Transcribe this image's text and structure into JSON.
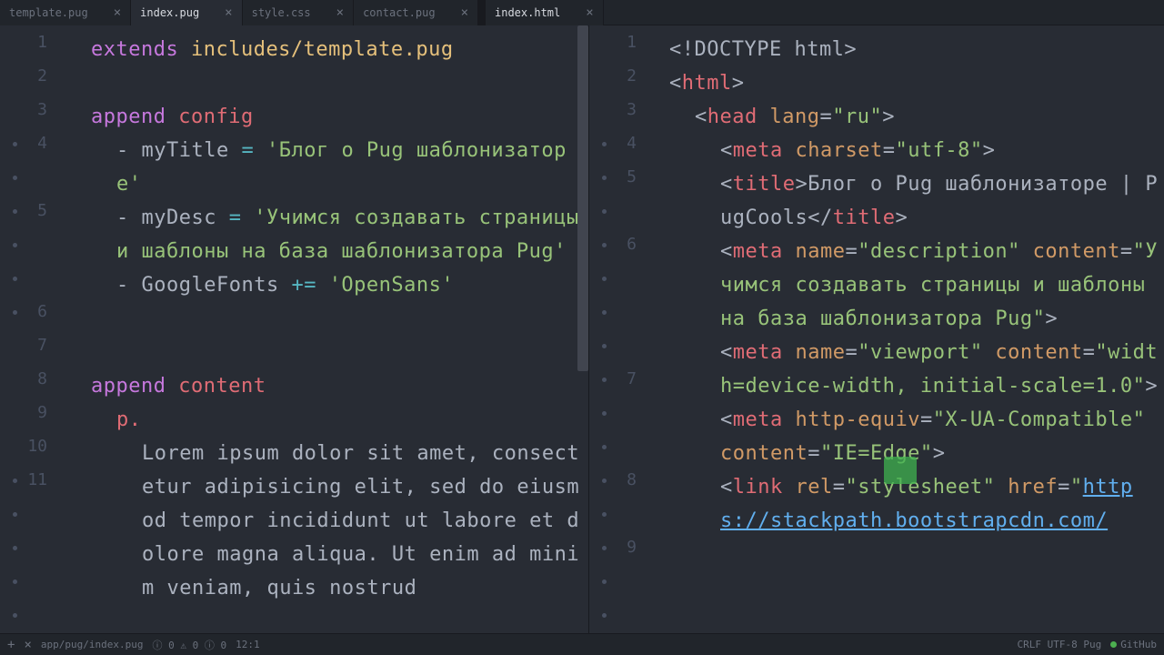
{
  "tabs": [
    {
      "label": "template.pug",
      "active": false
    },
    {
      "label": "index.pug",
      "active": true
    },
    {
      "label": "style.css",
      "active": false
    },
    {
      "label": "contact.pug",
      "active": false
    },
    {
      "label": "index.html",
      "active": true
    }
  ],
  "left_lines": [
    "1",
    "2",
    "3",
    "4",
    "",
    "5",
    "",
    "",
    "6",
    "7",
    "8",
    "9",
    "10",
    "11",
    "",
    "",
    "",
    ""
  ],
  "right_lines": [
    "1",
    "2",
    "3",
    "4",
    "5",
    "",
    "6",
    "",
    "",
    "",
    "7",
    "",
    "",
    "8",
    "",
    "9",
    "",
    ""
  ],
  "left_code": {
    "l1_kw": "extends",
    "l1_path": "includes/template.pug",
    "l3_kw": "append",
    "l3_name": "config",
    "l4_dash": "- ",
    "l4_var": "myTitle",
    "l4_eq": " = ",
    "l4_str": "'Блог о Pug шаблонизаторе'",
    "l5_dash": "- ",
    "l5_var": "myDesc",
    "l5_eq": " = ",
    "l5_str": "'Учимся создавать страницы и шаблоны на база шаблонизатора Pug'",
    "l6_dash": "- ",
    "l6_var": "GoogleFonts",
    "l6_eq": " += ",
    "l6_str": "'OpenSans'",
    "l9_kw": "append",
    "l9_name": "content",
    "l10_tag": "p.",
    "l11_text": "Lorem ipsum dolor sit amet, consectetur adipisicing elit, sed do eiusmod tempor incididunt ut labore et dolore magna aliqua. Ut enim ad minim veniam, quis nostrud"
  },
  "right_code": {
    "r1": "<!DOCTYPE html>",
    "r2_o": "<",
    "r2_t": "html",
    "r2_c": ">",
    "r3_o": "<",
    "r3_t": "head",
    "r3_sp": " ",
    "r3_a": "lang",
    "r3_eq": "=",
    "r3_v": "\"ru\"",
    "r3_c": ">",
    "r4_o": "<",
    "r4_t": "meta",
    "r4_sp": " ",
    "r4_a": "charset",
    "r4_eq": "=",
    "r4_v": "\"utf-8\"",
    "r4_c": ">",
    "r5_o": "<",
    "r5_t": "title",
    "r5_c": ">",
    "r5_txt": "Блог о Pug шаблонизаторе | PugCools",
    "r5_co": "</",
    "r5_ct": "title",
    "r5_cc": ">",
    "r6_o": "<",
    "r6_t": "meta",
    "r6_sp": " ",
    "r6_a1": "name",
    "r6_eq": "=",
    "r6_v1": "\"description\"",
    "r6_a2": "content",
    "r6_v2": "\"Учимся создавать страницы и шаблоны на база шаблонизатора Pug\"",
    "r6_c": ">",
    "r7_o": "<",
    "r7_t": "meta",
    "r7_sp": " ",
    "r7_a1": "name",
    "r7_eq": "=",
    "r7_v1": "\"viewport\"",
    "r7_a2": "content",
    "r7_v2": "\"width=device-width, initial-scale=1.0\"",
    "r7_c": ">",
    "r8_o": "<",
    "r8_t": "meta",
    "r8_sp": " ",
    "r8_a1": "http-equiv",
    "r8_eq": "=",
    "r8_v1": "\"X-UA-Compatible\"",
    "r8_a2": "content",
    "r8_v2": "\"IE=Edge\"",
    "r8_c": ">",
    "r9_o": "<",
    "r9_t": "link",
    "r9_sp": " ",
    "r9_a1": "rel",
    "r9_eq": "=",
    "r9_v1": "\"stylesheet\"",
    "r9_a2": "href",
    "r9_v2a": "\"",
    "r9_lnk": "https://stackpath.bootstrapcdn.com/"
  },
  "status": {
    "path": "app/pug/index.pug",
    "err": "0",
    "warn": "0",
    "info": "0",
    "pos": "12:1",
    "enc": "CRLF  UTF-8  Pug",
    "git": "GitHub"
  }
}
